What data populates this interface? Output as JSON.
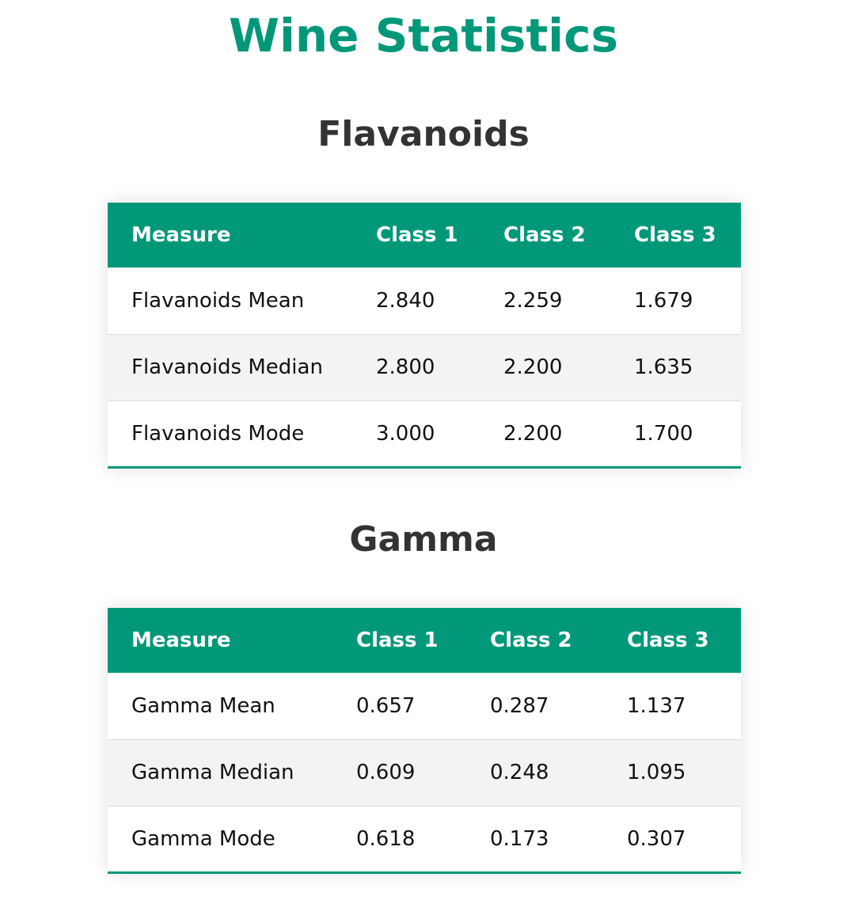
{
  "page": {
    "title": "Wine Statistics"
  },
  "colors": {
    "accent": "#009879",
    "heading": "#333333",
    "stripe": "#f3f3f3"
  },
  "flavanoids": {
    "title": "Flavanoids",
    "headers": [
      "Measure",
      "Class 1",
      "Class 2",
      "Class 3"
    ],
    "rows": [
      [
        "Flavanoids Mean",
        "2.840",
        "2.259",
        "1.679"
      ],
      [
        "Flavanoids Median",
        "2.800",
        "2.200",
        "1.635"
      ],
      [
        "Flavanoids Mode",
        "3.000",
        "2.200",
        "1.700"
      ]
    ]
  },
  "gamma": {
    "title": "Gamma",
    "headers": [
      "Measure",
      "Class 1",
      "Class 2",
      "Class 3"
    ],
    "rows": [
      [
        "Gamma Mean",
        "0.657",
        "0.287",
        "1.137"
      ],
      [
        "Gamma Median",
        "0.609",
        "0.248",
        "1.095"
      ],
      [
        "Gamma Mode",
        "0.618",
        "0.173",
        "0.307"
      ]
    ]
  }
}
